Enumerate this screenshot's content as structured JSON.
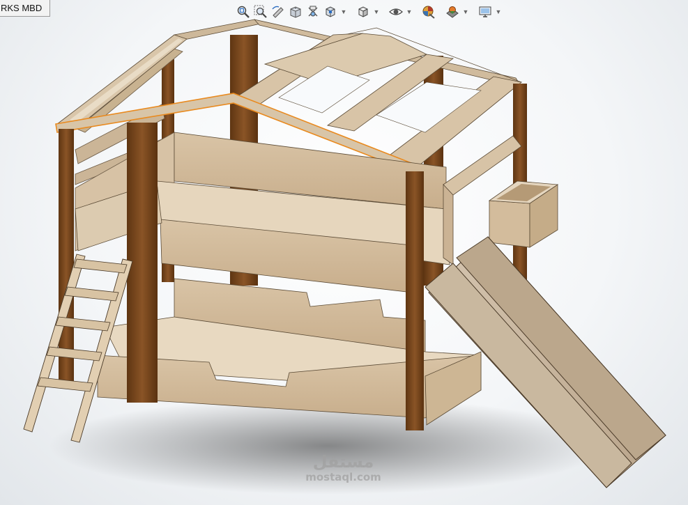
{
  "document_tab": {
    "label": "RKS MBD"
  },
  "toolbar": {
    "buttons": [
      {
        "icon": "zoom-to-fit-icon",
        "has_dropdown": false
      },
      {
        "icon": "zoom-to-area-icon",
        "has_dropdown": false
      },
      {
        "icon": "previous-view-icon",
        "has_dropdown": false
      },
      {
        "icon": "section-view-icon",
        "has_dropdown": false
      },
      {
        "icon": "dynamic-annotation-views-icon",
        "has_dropdown": false
      },
      {
        "icon": "view-orientation-icon",
        "has_dropdown": true
      },
      {
        "icon": "display-style-icon",
        "has_dropdown": true
      },
      {
        "icon": "hide-show-items-icon",
        "has_dropdown": true
      },
      {
        "icon": "edit-appearance-icon",
        "has_dropdown": false
      },
      {
        "icon": "apply-scene-icon",
        "has_dropdown": true
      },
      {
        "icon": "view-settings-icon",
        "has_dropdown": true
      }
    ]
  },
  "model": {
    "name": "bunk-bed-house-with-slide"
  },
  "watermark": {
    "logo_text": "مستقل",
    "url_text": "mostaql.com"
  }
}
